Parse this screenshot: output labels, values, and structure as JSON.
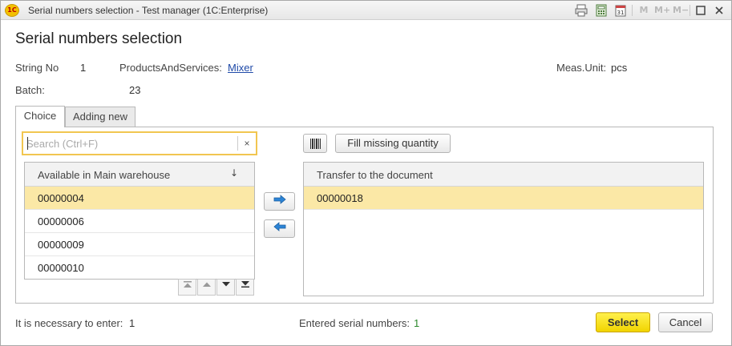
{
  "window": {
    "title": "Serial numbers selection  - Test manager (1C:Enterprise)",
    "logo_text": "1C",
    "toolbar": {
      "m": "M",
      "m_plus": "M+",
      "m_minus": "M−"
    }
  },
  "form": {
    "title": "Serial numbers selection",
    "string_no_label": "String No",
    "string_no_value": "1",
    "products_label": "ProductsAndServices:",
    "products_value": "Mixer",
    "meas_unit_label": "Meas.Unit:",
    "meas_unit_value": "pcs",
    "batch_label": "Batch:",
    "batch_value": "23"
  },
  "tabs": [
    {
      "label": "Choice",
      "active": true
    },
    {
      "label": "Adding new",
      "active": false
    }
  ],
  "search": {
    "placeholder": "Search (Ctrl+F)",
    "value": "",
    "clear_symbol": "×"
  },
  "available_list": {
    "header": "Available in Main warehouse",
    "sort_symbol": "↓",
    "rows": [
      "00000004",
      "00000006",
      "00000009",
      "00000010"
    ],
    "selected_index": 0
  },
  "nav_buttons": [
    "first",
    "previous",
    "next",
    "last"
  ],
  "move_buttons": {
    "right_symbol": "➔",
    "left_symbol": "➔"
  },
  "transfer_list": {
    "header": "Transfer to the document",
    "rows": [
      "00000018"
    ],
    "selected_index": 0
  },
  "buttons": {
    "fill_missing": "Fill missing quantity",
    "select": "Select",
    "cancel": "Cancel"
  },
  "footer": {
    "necessary_label": "It is necessary to enter:",
    "necessary_value": "1",
    "entered_label": "Entered serial numbers:",
    "entered_value": "1"
  },
  "colors": {
    "accent_yellow": "#f1d400",
    "selected_row": "#fbe8a6",
    "link": "#1f4aa8",
    "entered_value": "#2d8a2d"
  }
}
